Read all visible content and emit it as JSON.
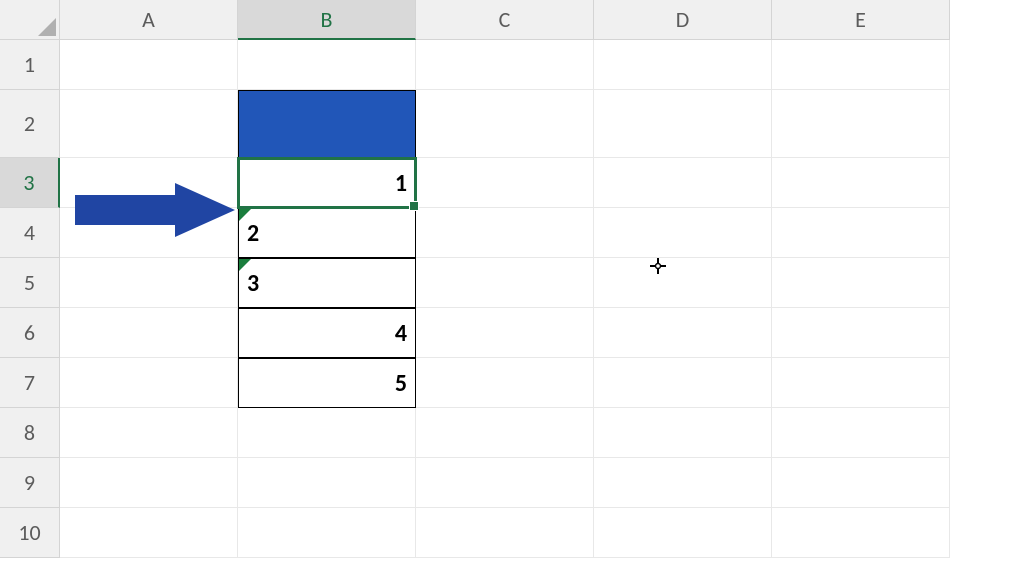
{
  "columns": [
    "A",
    "B",
    "C",
    "D",
    "E"
  ],
  "rows": [
    "1",
    "2",
    "3",
    "4",
    "5",
    "6",
    "7",
    "8",
    "9",
    "10"
  ],
  "active_column": "B",
  "active_row": "3",
  "cells": {
    "B2": {
      "value": "",
      "fill": "#2156b8",
      "bordered": true
    },
    "B3": {
      "value": "1",
      "align": "right",
      "bordered": true,
      "selected": true
    },
    "B4": {
      "value": "2",
      "align": "left",
      "bordered": true,
      "text_stored_as_number": true
    },
    "B5": {
      "value": "3",
      "align": "left",
      "bordered": true,
      "text_stored_as_number": true
    },
    "B6": {
      "value": "4",
      "align": "right",
      "bordered": true
    },
    "B7": {
      "value": "5",
      "align": "right",
      "bordered": true
    }
  },
  "annotation": {
    "arrow_color": "#2045a3",
    "points_to": "B3"
  },
  "cursor_position": {
    "near_cell": "D4"
  }
}
